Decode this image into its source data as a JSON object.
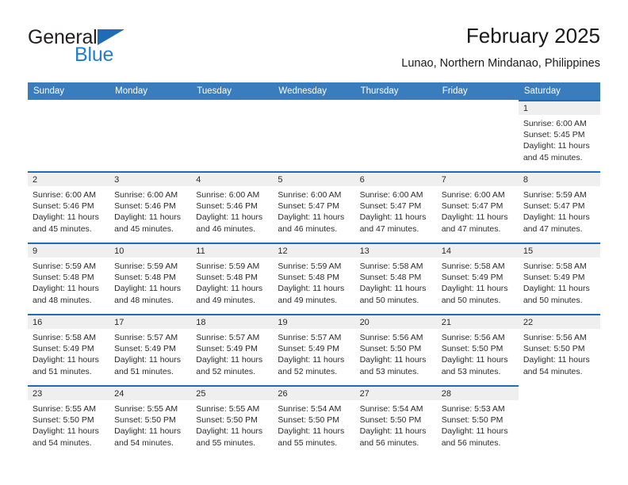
{
  "brand": {
    "name_part1": "General",
    "name_part2": "Blue",
    "triangle_icon": "blue-triangle-icon",
    "accent_color": "#1f6cb5",
    "blue_text_color": "#1f7fd0"
  },
  "header": {
    "title": "February 2025",
    "subtitle": "Lunao, Northern Mindanao, Philippines"
  },
  "calendar": {
    "header_background": "#3a7dbf",
    "daynum_band_background": "#efefef",
    "cell_top_border_color": "#1f6cb5",
    "weekdays": [
      "Sunday",
      "Monday",
      "Tuesday",
      "Wednesday",
      "Thursday",
      "Friday",
      "Saturday"
    ],
    "weeks": [
      [
        {
          "day": "",
          "lines": []
        },
        {
          "day": "",
          "lines": []
        },
        {
          "day": "",
          "lines": []
        },
        {
          "day": "",
          "lines": []
        },
        {
          "day": "",
          "lines": []
        },
        {
          "day": "",
          "lines": []
        },
        {
          "day": "1",
          "lines": [
            "Sunrise: 6:00 AM",
            "Sunset: 5:45 PM",
            "Daylight: 11 hours and 45 minutes."
          ]
        }
      ],
      [
        {
          "day": "2",
          "lines": [
            "Sunrise: 6:00 AM",
            "Sunset: 5:46 PM",
            "Daylight: 11 hours and 45 minutes."
          ]
        },
        {
          "day": "3",
          "lines": [
            "Sunrise: 6:00 AM",
            "Sunset: 5:46 PM",
            "Daylight: 11 hours and 45 minutes."
          ]
        },
        {
          "day": "4",
          "lines": [
            "Sunrise: 6:00 AM",
            "Sunset: 5:46 PM",
            "Daylight: 11 hours and 46 minutes."
          ]
        },
        {
          "day": "5",
          "lines": [
            "Sunrise: 6:00 AM",
            "Sunset: 5:47 PM",
            "Daylight: 11 hours and 46 minutes."
          ]
        },
        {
          "day": "6",
          "lines": [
            "Sunrise: 6:00 AM",
            "Sunset: 5:47 PM",
            "Daylight: 11 hours and 47 minutes."
          ]
        },
        {
          "day": "7",
          "lines": [
            "Sunrise: 6:00 AM",
            "Sunset: 5:47 PM",
            "Daylight: 11 hours and 47 minutes."
          ]
        },
        {
          "day": "8",
          "lines": [
            "Sunrise: 5:59 AM",
            "Sunset: 5:47 PM",
            "Daylight: 11 hours and 47 minutes."
          ]
        }
      ],
      [
        {
          "day": "9",
          "lines": [
            "Sunrise: 5:59 AM",
            "Sunset: 5:48 PM",
            "Daylight: 11 hours and 48 minutes."
          ]
        },
        {
          "day": "10",
          "lines": [
            "Sunrise: 5:59 AM",
            "Sunset: 5:48 PM",
            "Daylight: 11 hours and 48 minutes."
          ]
        },
        {
          "day": "11",
          "lines": [
            "Sunrise: 5:59 AM",
            "Sunset: 5:48 PM",
            "Daylight: 11 hours and 49 minutes."
          ]
        },
        {
          "day": "12",
          "lines": [
            "Sunrise: 5:59 AM",
            "Sunset: 5:48 PM",
            "Daylight: 11 hours and 49 minutes."
          ]
        },
        {
          "day": "13",
          "lines": [
            "Sunrise: 5:58 AM",
            "Sunset: 5:48 PM",
            "Daylight: 11 hours and 50 minutes."
          ]
        },
        {
          "day": "14",
          "lines": [
            "Sunrise: 5:58 AM",
            "Sunset: 5:49 PM",
            "Daylight: 11 hours and 50 minutes."
          ]
        },
        {
          "day": "15",
          "lines": [
            "Sunrise: 5:58 AM",
            "Sunset: 5:49 PM",
            "Daylight: 11 hours and 50 minutes."
          ]
        }
      ],
      [
        {
          "day": "16",
          "lines": [
            "Sunrise: 5:58 AM",
            "Sunset: 5:49 PM",
            "Daylight: 11 hours and 51 minutes."
          ]
        },
        {
          "day": "17",
          "lines": [
            "Sunrise: 5:57 AM",
            "Sunset: 5:49 PM",
            "Daylight: 11 hours and 51 minutes."
          ]
        },
        {
          "day": "18",
          "lines": [
            "Sunrise: 5:57 AM",
            "Sunset: 5:49 PM",
            "Daylight: 11 hours and 52 minutes."
          ]
        },
        {
          "day": "19",
          "lines": [
            "Sunrise: 5:57 AM",
            "Sunset: 5:49 PM",
            "Daylight: 11 hours and 52 minutes."
          ]
        },
        {
          "day": "20",
          "lines": [
            "Sunrise: 5:56 AM",
            "Sunset: 5:50 PM",
            "Daylight: 11 hours and 53 minutes."
          ]
        },
        {
          "day": "21",
          "lines": [
            "Sunrise: 5:56 AM",
            "Sunset: 5:50 PM",
            "Daylight: 11 hours and 53 minutes."
          ]
        },
        {
          "day": "22",
          "lines": [
            "Sunrise: 5:56 AM",
            "Sunset: 5:50 PM",
            "Daylight: 11 hours and 54 minutes."
          ]
        }
      ],
      [
        {
          "day": "23",
          "lines": [
            "Sunrise: 5:55 AM",
            "Sunset: 5:50 PM",
            "Daylight: 11 hours and 54 minutes."
          ]
        },
        {
          "day": "24",
          "lines": [
            "Sunrise: 5:55 AM",
            "Sunset: 5:50 PM",
            "Daylight: 11 hours and 54 minutes."
          ]
        },
        {
          "day": "25",
          "lines": [
            "Sunrise: 5:55 AM",
            "Sunset: 5:50 PM",
            "Daylight: 11 hours and 55 minutes."
          ]
        },
        {
          "day": "26",
          "lines": [
            "Sunrise: 5:54 AM",
            "Sunset: 5:50 PM",
            "Daylight: 11 hours and 55 minutes."
          ]
        },
        {
          "day": "27",
          "lines": [
            "Sunrise: 5:54 AM",
            "Sunset: 5:50 PM",
            "Daylight: 11 hours and 56 minutes."
          ]
        },
        {
          "day": "28",
          "lines": [
            "Sunrise: 5:53 AM",
            "Sunset: 5:50 PM",
            "Daylight: 11 hours and 56 minutes."
          ]
        },
        {
          "day": "",
          "lines": []
        }
      ]
    ]
  }
}
